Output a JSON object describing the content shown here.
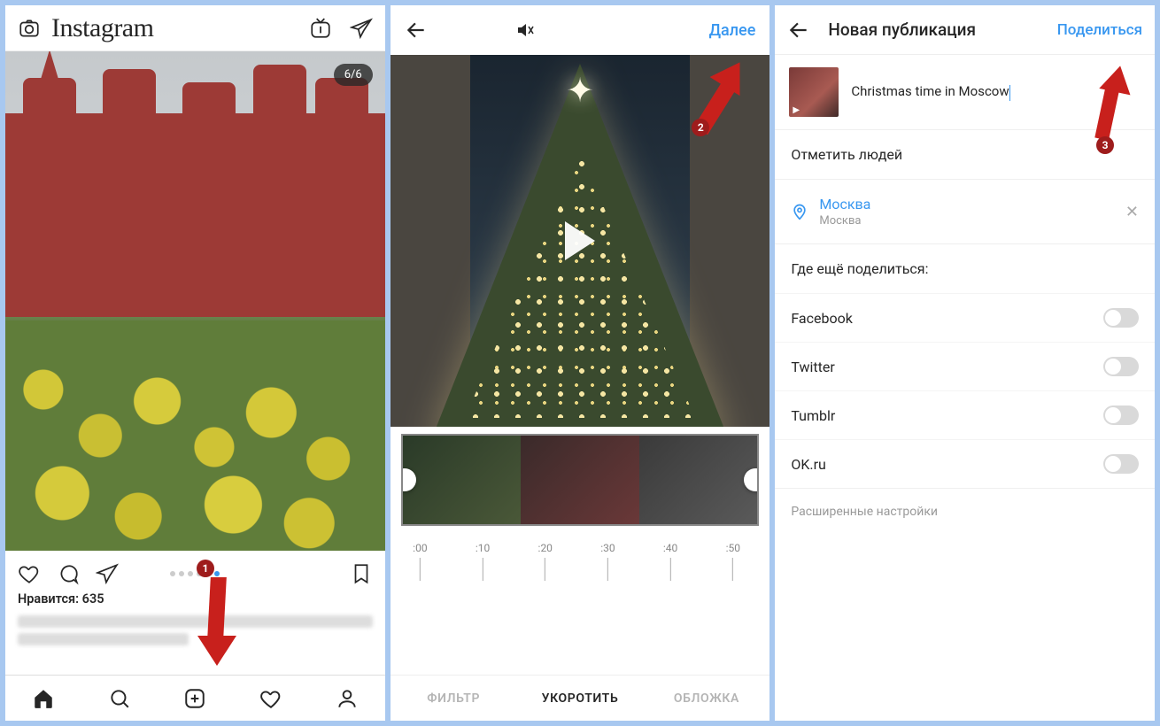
{
  "annotations": {
    "colors": {
      "arrow": "#c8201c",
      "badge": "#9e1c1c"
    },
    "steps": [
      "1",
      "2",
      "3"
    ]
  },
  "phone1": {
    "app": "Instagram",
    "header_icons": [
      "camera-icon",
      "igtv-icon",
      "direct-icon"
    ],
    "carousel_counter": "6/6",
    "likes_label": "Нравится: 635",
    "bottom_nav": [
      "home-icon",
      "search-icon",
      "add-icon",
      "heart-icon",
      "profile-icon"
    ]
  },
  "phone2": {
    "header": {
      "back_icon": "back-arrow-icon",
      "mute_icon": "mute-icon",
      "next_label": "Далее"
    },
    "ruler_ticks": [
      ":00",
      ":10",
      ":20",
      ":30",
      ":40",
      ":50"
    ],
    "trim_range": {
      "start": ":00",
      "end": ":50"
    },
    "tabs": {
      "filter": "ФИЛЬТР",
      "trim": "УКОРОТИТЬ",
      "cover": "ОБЛОЖКА",
      "active": "trim"
    },
    "annotation_badge": "2"
  },
  "phone3": {
    "header": {
      "back_icon": "back-arrow-icon",
      "title": "Новая публикация",
      "share_label": "Поделиться"
    },
    "caption_value": "Christmas time in Moscow",
    "tag_people_label": "Отметить людей",
    "location": {
      "name": "Москва",
      "subtitle": "Москва"
    },
    "share_section_title": "Где ещё поделиться:",
    "share_targets": [
      {
        "name": "Facebook",
        "on": false
      },
      {
        "name": "Twitter",
        "on": false
      },
      {
        "name": "Tumblr",
        "on": false
      },
      {
        "name": "OK.ru",
        "on": false
      }
    ],
    "advanced_label": "Расширенные настройки",
    "annotation_badge": "3"
  }
}
